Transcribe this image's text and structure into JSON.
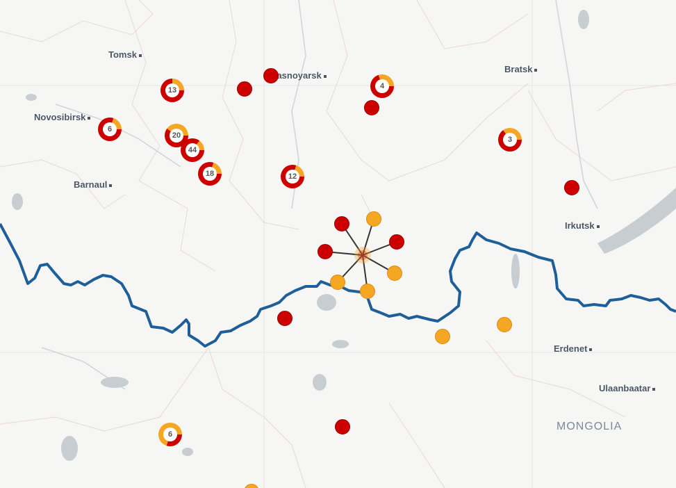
{
  "map": {
    "cities": [
      {
        "name": "Tomsk",
        "id": "tomsk"
      },
      {
        "name": "Krasnoyarsk",
        "id": "krasnoyarsk"
      },
      {
        "name": "Bratsk",
        "id": "bratsk"
      },
      {
        "name": "Novosibirsk",
        "id": "novosibirsk"
      },
      {
        "name": "Barnaul",
        "id": "barnaul"
      },
      {
        "name": "Irkutsk",
        "id": "irkutsk"
      },
      {
        "name": "Erdenet",
        "id": "erdenet"
      },
      {
        "name": "Ulaanbaatar",
        "id": "ulaanbaatar"
      }
    ],
    "country_label": "MONGOLIA",
    "clusters": [
      {
        "count": "13",
        "red_fraction": 0.75
      },
      {
        "count": "4",
        "red_fraction": 0.7
      },
      {
        "count": "6",
        "red_fraction": 0.8
      },
      {
        "count": "20",
        "red_fraction": 0.6
      },
      {
        "count": "44",
        "red_fraction": 0.85
      },
      {
        "count": "18",
        "red_fraction": 0.8
      },
      {
        "count": "12",
        "red_fraction": 0.8
      },
      {
        "count": "3",
        "red_fraction": 0.65
      },
      {
        "count": "6",
        "red_fraction": 0.3
      }
    ],
    "colors": {
      "red": "#cc0000",
      "orange": "#f5a623",
      "border": "#1f5f99",
      "water": "#c8cdd2",
      "land": "#f6f6f4"
    }
  }
}
